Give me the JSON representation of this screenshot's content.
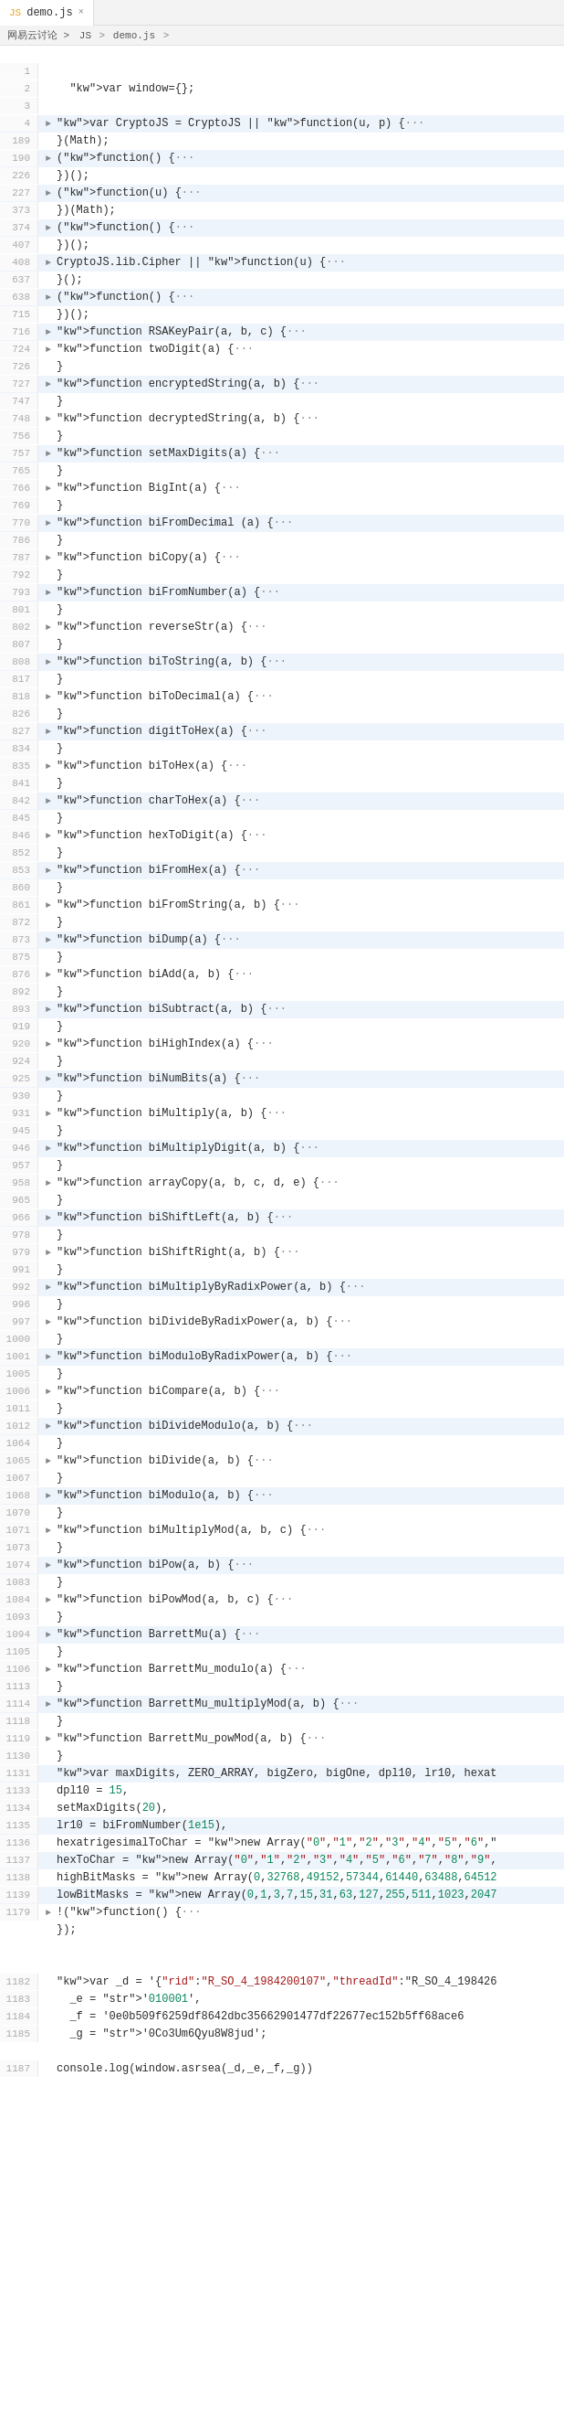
{
  "tab": {
    "icon": "JS",
    "filename": "demo.js",
    "close": "×"
  },
  "breadcrumb": {
    "parts": [
      "网易云讨论 >",
      "JS",
      "demo.js",
      ">"
    ]
  },
  "lines": [
    {
      "num": "",
      "arrow": "",
      "content": "",
      "highlight": false
    },
    {
      "num": "1",
      "arrow": "",
      "content": "",
      "highlight": false
    },
    {
      "num": "2",
      "arrow": "",
      "content": "  var window={};",
      "highlight": false
    },
    {
      "num": "3",
      "arrow": "",
      "content": "",
      "highlight": false
    },
    {
      "num": "4",
      "arrow": ">",
      "content": "var CryptoJS = CryptoJS || function(u, p) {···",
      "highlight": true
    },
    {
      "num": "189",
      "arrow": "",
      "content": "}(Math);",
      "highlight": false
    },
    {
      "num": "190",
      "arrow": ">",
      "content": "(function() {···",
      "highlight": true
    },
    {
      "num": "226",
      "arrow": "",
      "content": "})();",
      "highlight": false
    },
    {
      "num": "227",
      "arrow": ">",
      "content": "(function(u) {···",
      "highlight": true
    },
    {
      "num": "373",
      "arrow": "",
      "content": "})(Math);",
      "highlight": false
    },
    {
      "num": "374",
      "arrow": ">",
      "content": "(function() {···",
      "highlight": true
    },
    {
      "num": "407",
      "arrow": "",
      "content": "})();",
      "highlight": false
    },
    {
      "num": "408",
      "arrow": ">",
      "content": "CryptoJS.lib.Cipher || function(u) {···",
      "highlight": true
    },
    {
      "num": "637",
      "arrow": "",
      "content": "}();",
      "highlight": false
    },
    {
      "num": "638",
      "arrow": ">",
      "content": "(function() {···",
      "highlight": true
    },
    {
      "num": "715",
      "arrow": "",
      "content": "})();",
      "highlight": false
    },
    {
      "num": "716",
      "arrow": ">",
      "content": "function RSAKeyPair(a, b, c) {···",
      "highlight": true
    },
    {
      "num": "724",
      "arrow": ">",
      "content": "function twoDigit(a) {···",
      "highlight": false
    },
    {
      "num": "726",
      "arrow": "",
      "content": "}",
      "highlight": false
    },
    {
      "num": "727",
      "arrow": ">",
      "content": "function encryptedString(a, b) {···",
      "highlight": true
    },
    {
      "num": "747",
      "arrow": "",
      "content": "}",
      "highlight": false
    },
    {
      "num": "748",
      "arrow": ">",
      "content": "function decryptedString(a, b) {···",
      "highlight": false
    },
    {
      "num": "756",
      "arrow": "",
      "content": "}",
      "highlight": false
    },
    {
      "num": "757",
      "arrow": ">",
      "content": "function setMaxDigits(a) {···",
      "highlight": true
    },
    {
      "num": "765",
      "arrow": "",
      "content": "}",
      "highlight": false
    },
    {
      "num": "766",
      "arrow": ">",
      "content": "function BigInt(a) {···",
      "highlight": false
    },
    {
      "num": "769",
      "arrow": "",
      "content": "}",
      "highlight": false
    },
    {
      "num": "770",
      "arrow": ">",
      "content": "function biFromDecimal (a) {···",
      "highlight": true
    },
    {
      "num": "786",
      "arrow": "",
      "content": "}",
      "highlight": false
    },
    {
      "num": "787",
      "arrow": ">",
      "content": "function biCopy(a) {···",
      "highlight": false
    },
    {
      "num": "792",
      "arrow": "",
      "content": "}",
      "highlight": false
    },
    {
      "num": "793",
      "arrow": ">",
      "content": "function biFromNumber(a) {···",
      "highlight": true
    },
    {
      "num": "801",
      "arrow": "",
      "content": "}",
      "highlight": false
    },
    {
      "num": "802",
      "arrow": ">",
      "content": "function reverseStr(a) {···",
      "highlight": false
    },
    {
      "num": "807",
      "arrow": "",
      "content": "}",
      "highlight": false
    },
    {
      "num": "808",
      "arrow": ">",
      "content": "function biToString(a, b) {···",
      "highlight": true
    },
    {
      "num": "817",
      "arrow": "",
      "content": "}",
      "highlight": false
    },
    {
      "num": "818",
      "arrow": ">",
      "content": "function biToDecimal(a) {···",
      "highlight": false
    },
    {
      "num": "826",
      "arrow": "",
      "content": "}",
      "highlight": false
    },
    {
      "num": "827",
      "arrow": ">",
      "content": "function digitToHex(a) {···",
      "highlight": true
    },
    {
      "num": "834",
      "arrow": "",
      "content": "}",
      "highlight": false
    },
    {
      "num": "835",
      "arrow": ">",
      "content": "function biToHex(a) {···",
      "highlight": false
    },
    {
      "num": "841",
      "arrow": "",
      "content": "}",
      "highlight": false
    },
    {
      "num": "842",
      "arrow": ">",
      "content": "function charToHex(a) {···",
      "highlight": true
    },
    {
      "num": "845",
      "arrow": "",
      "content": "}",
      "highlight": false
    },
    {
      "num": "846",
      "arrow": ">",
      "content": "function hexToDigit(a) {···",
      "highlight": false
    },
    {
      "num": "852",
      "arrow": "",
      "content": "}",
      "highlight": false
    },
    {
      "num": "853",
      "arrow": ">",
      "content": "function biFromHex(a) {···",
      "highlight": true
    },
    {
      "num": "860",
      "arrow": "",
      "content": "}",
      "highlight": false
    },
    {
      "num": "861",
      "arrow": ">",
      "content": "function biFromString(a, b) {···",
      "highlight": false
    },
    {
      "num": "872",
      "arrow": "",
      "content": "}",
      "highlight": false
    },
    {
      "num": "873",
      "arrow": ">",
      "content": "function biDump(a) {···",
      "highlight": true
    },
    {
      "num": "875",
      "arrow": "",
      "content": "}",
      "highlight": false
    },
    {
      "num": "876",
      "arrow": ">",
      "content": "function biAdd(a, b) {···",
      "highlight": false
    },
    {
      "num": "892",
      "arrow": "",
      "content": "}",
      "highlight": false
    },
    {
      "num": "893",
      "arrow": ">",
      "content": "function biSubtract(a, b) {···",
      "highlight": true
    },
    {
      "num": "919",
      "arrow": "",
      "content": "}",
      "highlight": false
    },
    {
      "num": "920",
      "arrow": ">",
      "content": "function biHighIndex(a) {···",
      "highlight": false
    },
    {
      "num": "924",
      "arrow": "",
      "content": "}",
      "highlight": false
    },
    {
      "num": "925",
      "arrow": ">",
      "content": "function biNumBits(a) {···",
      "highlight": true
    },
    {
      "num": "930",
      "arrow": "",
      "content": "}",
      "highlight": false
    },
    {
      "num": "931",
      "arrow": ">",
      "content": "function biMultiply(a, b) {···",
      "highlight": false
    },
    {
      "num": "945",
      "arrow": "",
      "content": "}",
      "highlight": false
    },
    {
      "num": "946",
      "arrow": ">",
      "content": "function biMultiplyDigit(a, b) {···",
      "highlight": true
    },
    {
      "num": "957",
      "arrow": "",
      "content": "}",
      "highlight": false
    },
    {
      "num": "958",
      "arrow": ">",
      "content": "function arrayCopy(a, b, c, d, e) {···",
      "highlight": false
    },
    {
      "num": "965",
      "arrow": "",
      "content": "}",
      "highlight": false
    },
    {
      "num": "966",
      "arrow": ">",
      "content": "function biShiftLeft(a, b) {···",
      "highlight": true
    },
    {
      "num": "978",
      "arrow": "",
      "content": "}",
      "highlight": false
    },
    {
      "num": "979",
      "arrow": ">",
      "content": "function biShiftRight(a, b) {···",
      "highlight": false
    },
    {
      "num": "991",
      "arrow": "",
      "content": "}",
      "highlight": false
    },
    {
      "num": "992",
      "arrow": ">",
      "content": "function biMultiplyByRadixPower(a, b) {···",
      "highlight": true
    },
    {
      "num": "996",
      "arrow": "",
      "content": "}",
      "highlight": false
    },
    {
      "num": "997",
      "arrow": ">",
      "content": "function biDivideByRadixPower(a, b) {···",
      "highlight": false
    },
    {
      "num": "1000",
      "arrow": "",
      "content": "}",
      "highlight": false
    },
    {
      "num": "1001",
      "arrow": ">",
      "content": "function biModuloByRadixPower(a, b) {···",
      "highlight": true
    },
    {
      "num": "1005",
      "arrow": "",
      "content": "}",
      "highlight": false
    },
    {
      "num": "1006",
      "arrow": ">",
      "content": "function biCompare(a, b) {···",
      "highlight": false
    },
    {
      "num": "1011",
      "arrow": "",
      "content": "}",
      "highlight": false
    },
    {
      "num": "1012",
      "arrow": ">",
      "content": "function biDivideModulo(a, b) {···",
      "highlight": true
    },
    {
      "num": "1064",
      "arrow": "",
      "content": "}",
      "highlight": false
    },
    {
      "num": "1065",
      "arrow": ">",
      "content": "function biDivide(a, b) {···",
      "highlight": false
    },
    {
      "num": "1067",
      "arrow": "",
      "content": "}",
      "highlight": false
    },
    {
      "num": "1068",
      "arrow": ">",
      "content": "function biModulo(a, b) {···",
      "highlight": true
    },
    {
      "num": "1070",
      "arrow": "",
      "content": "}",
      "highlight": false
    },
    {
      "num": "1071",
      "arrow": ">",
      "content": "function biMultiplyMod(a, b, c) {···",
      "highlight": false
    },
    {
      "num": "1073",
      "arrow": "",
      "content": "}",
      "highlight": false
    },
    {
      "num": "1074",
      "arrow": ">",
      "content": "function biPow(a, b) {···",
      "highlight": true
    },
    {
      "num": "1083",
      "arrow": "",
      "content": "}",
      "highlight": false
    },
    {
      "num": "1084",
      "arrow": ">",
      "content": "function biPowMod(a, b, c) {···",
      "highlight": false
    },
    {
      "num": "1093",
      "arrow": "",
      "content": "}",
      "highlight": false
    },
    {
      "num": "1094",
      "arrow": ">",
      "content": "function BarrettMu(a) {···",
      "highlight": true
    },
    {
      "num": "1105",
      "arrow": "",
      "content": "}",
      "highlight": false
    },
    {
      "num": "1106",
      "arrow": ">",
      "content": "function BarrettMu_modulo(a) {···",
      "highlight": false
    },
    {
      "num": "1113",
      "arrow": "",
      "content": "}",
      "highlight": false
    },
    {
      "num": "1114",
      "arrow": ">",
      "content": "function BarrettMu_multiplyMod(a, b) {···",
      "highlight": true
    },
    {
      "num": "1118",
      "arrow": "",
      "content": "}",
      "highlight": false
    },
    {
      "num": "1119",
      "arrow": ">",
      "content": "function BarrettMu_powMod(a, b) {···",
      "highlight": false
    },
    {
      "num": "1130",
      "arrow": "",
      "content": "}",
      "highlight": false
    },
    {
      "num": "1131",
      "arrow": "",
      "content": "var maxDigits, ZERO_ARRAY, bigZero, bigOne, dpl10, lr10, hexat",
      "highlight": true
    },
    {
      "num": "1133",
      "arrow": "",
      "content": "dpl10 = 15,",
      "highlight": false
    },
    {
      "num": "1134",
      "arrow": "",
      "content": "setMaxDigits(20),",
      "highlight": false
    },
    {
      "num": "1135",
      "arrow": "",
      "content": "lr10 = biFromNumber(1e15),",
      "highlight": true
    },
    {
      "num": "1136",
      "arrow": "",
      "content": "hexatrigesimalToChar = new Array(\"0\",\"1\",\"2\",\"3\",\"4\",\"5\",\"6\",\"",
      "highlight": false
    },
    {
      "num": "1137",
      "arrow": "",
      "content": "hexToChar = new Array(\"0\",\"1\",\"2\",\"3\",\"4\",\"5\",\"6\",\"7\",\"8\",\"9\",",
      "highlight": true
    },
    {
      "num": "1138",
      "arrow": "",
      "content": "highBitMasks = new Array(0,32768,49152,57344,61440,63488,64512",
      "highlight": false
    },
    {
      "num": "1139",
      "arrow": "",
      "content": "lowBitMasks = new Array(0,1,3,7,15,31,63,127,255,511,1023,2047",
      "highlight": true
    },
    {
      "num": "1179",
      "arrow": ">",
      "content": "!(function() {···",
      "highlight": false
    },
    {
      "num": "",
      "arrow": "",
      "content": "});",
      "highlight": false
    },
    {
      "num": "",
      "arrow": "",
      "content": "",
      "highlight": false
    },
    {
      "num": "",
      "arrow": "",
      "content": "",
      "highlight": false
    },
    {
      "num": "1182",
      "arrow": "",
      "content": "var _d = '{\"rid\":\"R_SO_4_1984200107\",\"threadId\":\"R_SO_4_198426",
      "highlight": false
    },
    {
      "num": "1183",
      "arrow": "",
      "content": "  _e = '010001',",
      "highlight": false
    },
    {
      "num": "1184",
      "arrow": "",
      "content": "  _f = '0e0b509f6259df8642dbc35662901477df22677ec152b5ff68ace6",
      "highlight": false
    },
    {
      "num": "1185",
      "arrow": "",
      "content": "  _g = '0Co3Um6Qyu8W8jud';",
      "highlight": false
    },
    {
      "num": "",
      "arrow": "",
      "content": "",
      "highlight": false
    },
    {
      "num": "1187",
      "arrow": "",
      "content": "console.log(window.asrsea(_d,_e,_f,_g))",
      "highlight": false
    }
  ]
}
